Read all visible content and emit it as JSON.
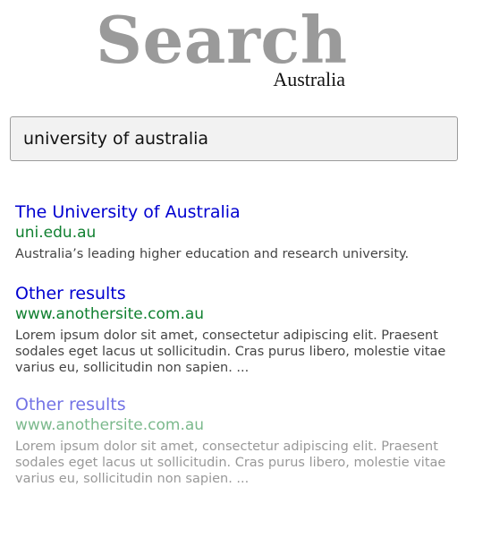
{
  "logo": {
    "title": "Search",
    "subtitle": "Australia"
  },
  "search": {
    "value": "university of australia"
  },
  "results": [
    {
      "title": "The University of Australia",
      "url": "uni.edu.au",
      "description": "Australia’s leading higher education and research university."
    },
    {
      "title": "Other results",
      "url": "www.anothersite.com.au",
      "description": "Lorem ipsum dolor sit amet, consectetur adipiscing elit. Praesent sodales eget lacus ut sollicitudin. Cras purus libero, molestie vitae varius eu, sollicitudin non sapien. ..."
    },
    {
      "title": "Other results",
      "url": "www.anothersite.com.au",
      "description": "Lorem ipsum dolor sit amet, consectetur adipiscing elit. Praesent sodales eget lacus ut sollicitudin. Cras purus libero, molestie vitae varius eu, sollicitudin non sapien. ..."
    }
  ],
  "colors": {
    "logo": "#9a9a9a",
    "link": "#0000d0",
    "url": "#108030",
    "text": "#444444",
    "input_bg": "#f2f2f2"
  }
}
